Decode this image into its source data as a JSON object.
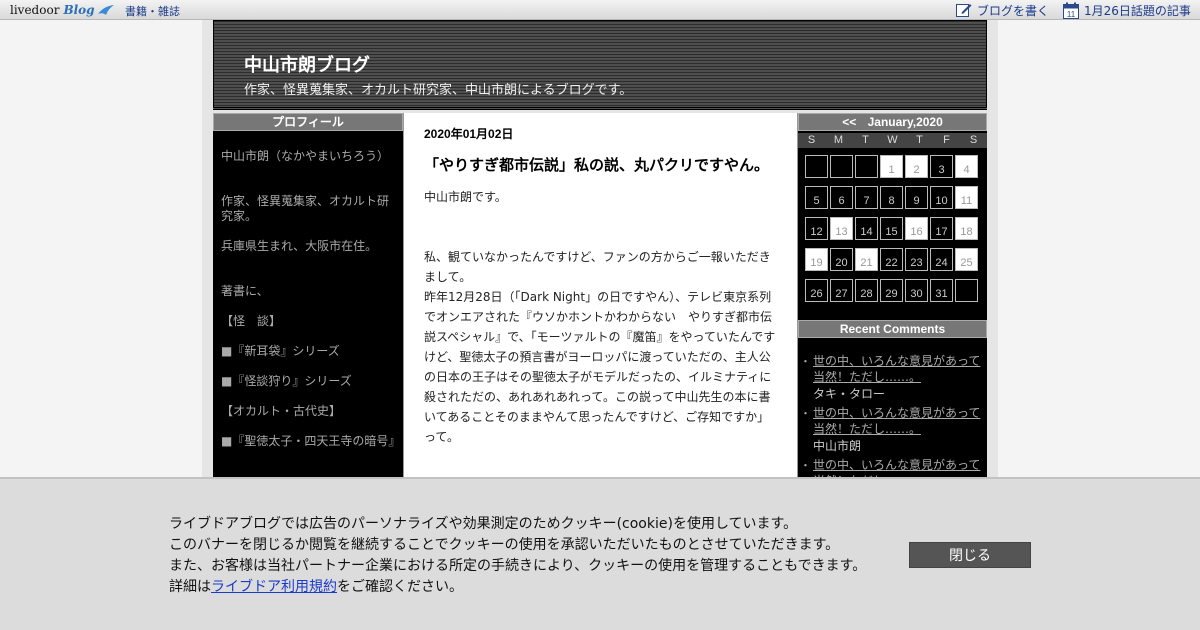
{
  "topbar": {
    "logo_text": "livedoor",
    "logo_blog": "Blog",
    "nav_link": "書籍・雑誌",
    "write_link": "ブログを書く",
    "calendar_day": "11",
    "topic_link": "1月26日話題の記事"
  },
  "header": {
    "title": "中山市朗ブログ",
    "description": "作家、怪異蒐集家、オカルト研究家、中山市朗によるブログです。"
  },
  "profile": {
    "heading": "プロフィール",
    "lines": [
      "中山市朗（なかやまいちろう）",
      "作家、怪異蒐集家、オカルト研究家。",
      "兵庫県生まれ、大阪市在住。",
      "著書に、",
      "【怪　談】",
      "■『新耳袋』シリーズ",
      "■『怪談狩り』シリーズ",
      "【オカルト・古代史】",
      "■『聖徳太子・四天王寺の暗号』"
    ]
  },
  "post": {
    "date": "2020年01月02日",
    "title": "「やりすぎ都市伝説」私の説、丸パクリですやん。",
    "para1": "中山市朗です。",
    "para2": "私、観ていなかったんですけど、ファンの方からご一報いただきまして。",
    "para3": "昨年12月28日（「Dark Night」の日ですやん）、テレビ東京系列でオンエアされた『ウソかホントかわからない　やりすぎ都市伝説スペシャル』で、「モーツァルトの『魔笛』をやっていたんですけど、聖徳太子の預言書がヨーロッパに渡っていただの、主人公の日本の王子はその聖徳太子がモデルだったの、イルミナティに殺されただの、あれあれあれって。この説って中山先生の本に書いてあることそのままやんて思ったんですけど、ご存知ですか」って。"
  },
  "calendar": {
    "prev": "<<",
    "month": "January,2020",
    "weekdays": [
      "S",
      "M",
      "T",
      "W",
      "T",
      "F",
      "S"
    ],
    "cells": [
      {
        "d": "",
        "light": false
      },
      {
        "d": "",
        "light": false
      },
      {
        "d": "",
        "light": false
      },
      {
        "d": "1",
        "light": true
      },
      {
        "d": "2",
        "light": true
      },
      {
        "d": "3",
        "light": false
      },
      {
        "d": "4",
        "light": true
      },
      {
        "d": "5",
        "light": false
      },
      {
        "d": "6",
        "light": false
      },
      {
        "d": "7",
        "light": false
      },
      {
        "d": "8",
        "light": false
      },
      {
        "d": "9",
        "light": false
      },
      {
        "d": "10",
        "light": false
      },
      {
        "d": "11",
        "light": true
      },
      {
        "d": "12",
        "light": false
      },
      {
        "d": "13",
        "light": true
      },
      {
        "d": "14",
        "light": false
      },
      {
        "d": "15",
        "light": false
      },
      {
        "d": "16",
        "light": true
      },
      {
        "d": "17",
        "light": false
      },
      {
        "d": "18",
        "light": true
      },
      {
        "d": "19",
        "light": true
      },
      {
        "d": "20",
        "light": false
      },
      {
        "d": "21",
        "light": true
      },
      {
        "d": "22",
        "light": false
      },
      {
        "d": "23",
        "light": false
      },
      {
        "d": "24",
        "light": false
      },
      {
        "d": "25",
        "light": true
      },
      {
        "d": "26",
        "light": false
      },
      {
        "d": "27",
        "light": false
      },
      {
        "d": "28",
        "light": false
      },
      {
        "d": "29",
        "light": false
      },
      {
        "d": "30",
        "light": false
      },
      {
        "d": "31",
        "light": false
      },
      {
        "d": "",
        "light": false
      }
    ]
  },
  "recent_comments": {
    "heading": "Recent Comments",
    "items": [
      {
        "title": "世の中、いろんな意見があって当然！ただし……。",
        "author": "タキ・タロー"
      },
      {
        "title": "世の中、いろんな意見があって当然！ただし……。",
        "author": "中山市朗"
      },
      {
        "title": "世の中、いろんな意見があって当然！ただし……。",
        "author": ""
      }
    ]
  },
  "cookie": {
    "line1": "ライブドアブログでは広告のパーソナライズや効果測定のためクッキー(cookie)を使用しています。",
    "line2": "このバナーを閉じるか閲覧を継続することでクッキーの使用を承認いただいたものとさせていただきます。",
    "line3": "また、お客様は当社パートナー企業における所定の手続きにより、クッキーの使用を管理することもできます。",
    "line4_pre": "詳細は",
    "line4_link": "ライブドア利用規約",
    "line4_post": "をご確認ください。",
    "close_label": "閉じる"
  }
}
